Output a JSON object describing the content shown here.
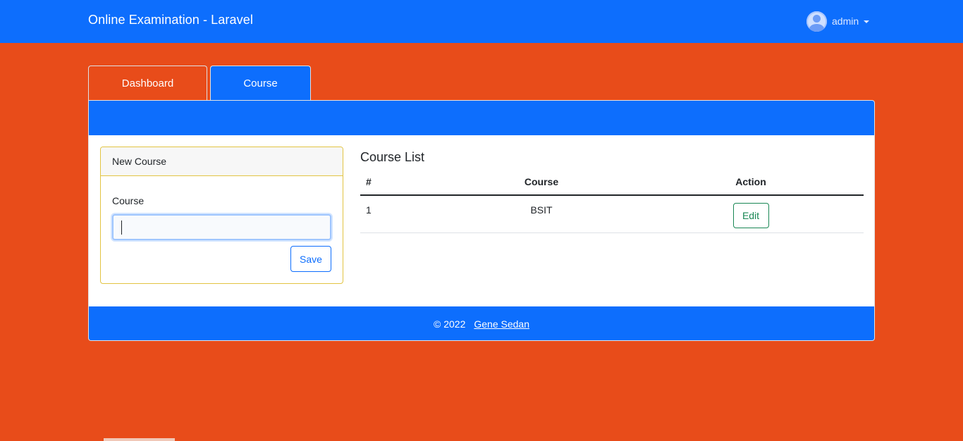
{
  "app": {
    "title": "Online Examination - Laravel"
  },
  "user": {
    "name": "admin",
    "avatar_icon": "user-avatar-icon"
  },
  "tabs": [
    {
      "label": "Dashboard"
    },
    {
      "label": "Course"
    }
  ],
  "form": {
    "header": "New Course",
    "field_label": "Course",
    "value": "",
    "save_label": "Save"
  },
  "list": {
    "title": "Course List",
    "columns": [
      "#",
      "Course",
      "Action"
    ],
    "rows": [
      {
        "num": "1",
        "course": "BSIT",
        "action_label": "Edit"
      }
    ]
  },
  "footer": {
    "copyright": "© 2022",
    "author": "Gene Sedan"
  },
  "colors": {
    "primary": "#0d6efd",
    "background": "#e84c1a",
    "form_border": "#e2c442",
    "edit_button": "#198754"
  }
}
